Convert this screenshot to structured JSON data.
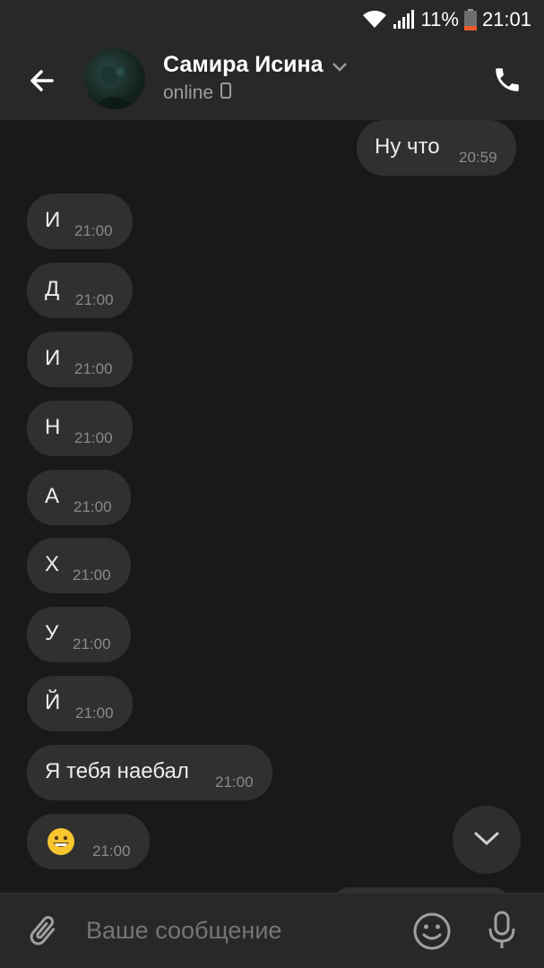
{
  "status_bar": {
    "battery": "11%",
    "time": "21:01"
  },
  "header": {
    "contact_name": "Самира Исина",
    "status": "online"
  },
  "messages": [
    {
      "side": "out",
      "text": "Ну что",
      "time": "20:59"
    },
    {
      "side": "in",
      "text": "И",
      "time": "21:00"
    },
    {
      "side": "in",
      "text": "Д",
      "time": "21:00"
    },
    {
      "side": "in",
      "text": "И",
      "time": "21:00"
    },
    {
      "side": "in",
      "text": "Н",
      "time": "21:00"
    },
    {
      "side": "in",
      "text": "А",
      "time": "21:00"
    },
    {
      "side": "in",
      "text": "Х",
      "time": "21:00"
    },
    {
      "side": "in",
      "text": "У",
      "time": "21:00"
    },
    {
      "side": "in",
      "text": "Й",
      "time": "21:00"
    },
    {
      "side": "in",
      "text": "Я тебя наебал",
      "time": "21:00"
    },
    {
      "side": "in",
      "emoji": "grinning-face",
      "time": "21:00"
    }
  ],
  "composer": {
    "placeholder": "Ваше сообщение"
  },
  "colors": {
    "background": "#191919",
    "bar": "#282828",
    "bubble": "#303030"
  }
}
